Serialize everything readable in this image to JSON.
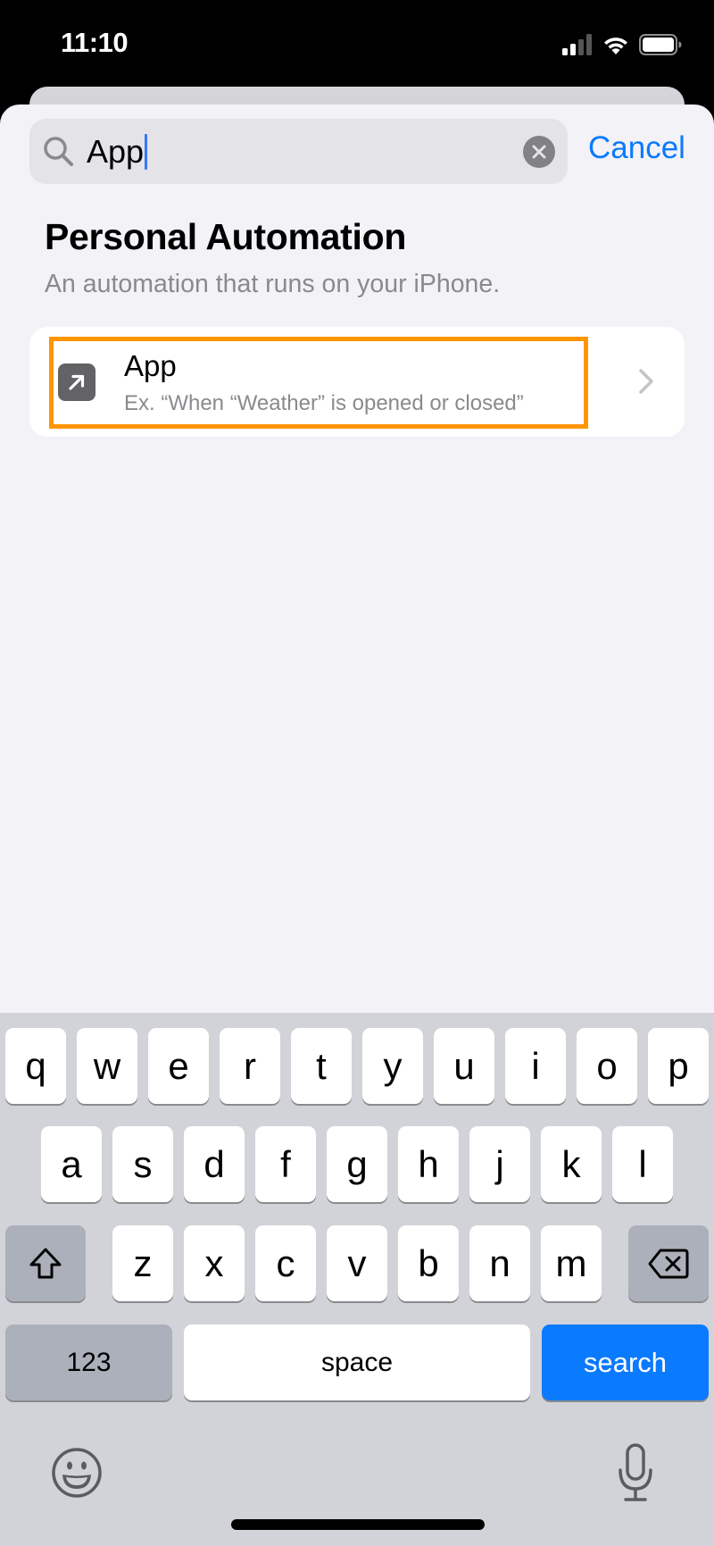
{
  "status_bar": {
    "time": "11:10",
    "icons": [
      "cellular-signal-icon",
      "wifi-icon",
      "battery-icon"
    ]
  },
  "search": {
    "value": "App",
    "clear_icon": "clear-circle-icon",
    "cancel_label": "Cancel"
  },
  "section": {
    "title": "Personal Automation",
    "subtitle": "An automation that runs on your iPhone."
  },
  "results": [
    {
      "icon": "arrow-up-right-square-icon",
      "title": "App",
      "subtitle": "Ex. “When “Weather” is opened or closed”",
      "highlighted": true,
      "highlight_color": "#ff9500"
    }
  ],
  "keyboard": {
    "row1": [
      "q",
      "w",
      "e",
      "r",
      "t",
      "y",
      "u",
      "i",
      "o",
      "p"
    ],
    "row2": [
      "a",
      "s",
      "d",
      "f",
      "g",
      "h",
      "j",
      "k",
      "l"
    ],
    "row3": [
      "z",
      "x",
      "c",
      "v",
      "b",
      "n",
      "m"
    ],
    "shift_icon": "shift-icon",
    "delete_icon": "delete-backward-icon",
    "numbers_label": "123",
    "space_label": "space",
    "return_label": "search",
    "return_color": "#0a7aff",
    "emoji_icon": "emoji-icon",
    "mic_icon": "microphone-icon"
  },
  "colors": {
    "accent": "#0a7aff",
    "highlight": "#ff9500",
    "background": "#f2f2f7"
  }
}
